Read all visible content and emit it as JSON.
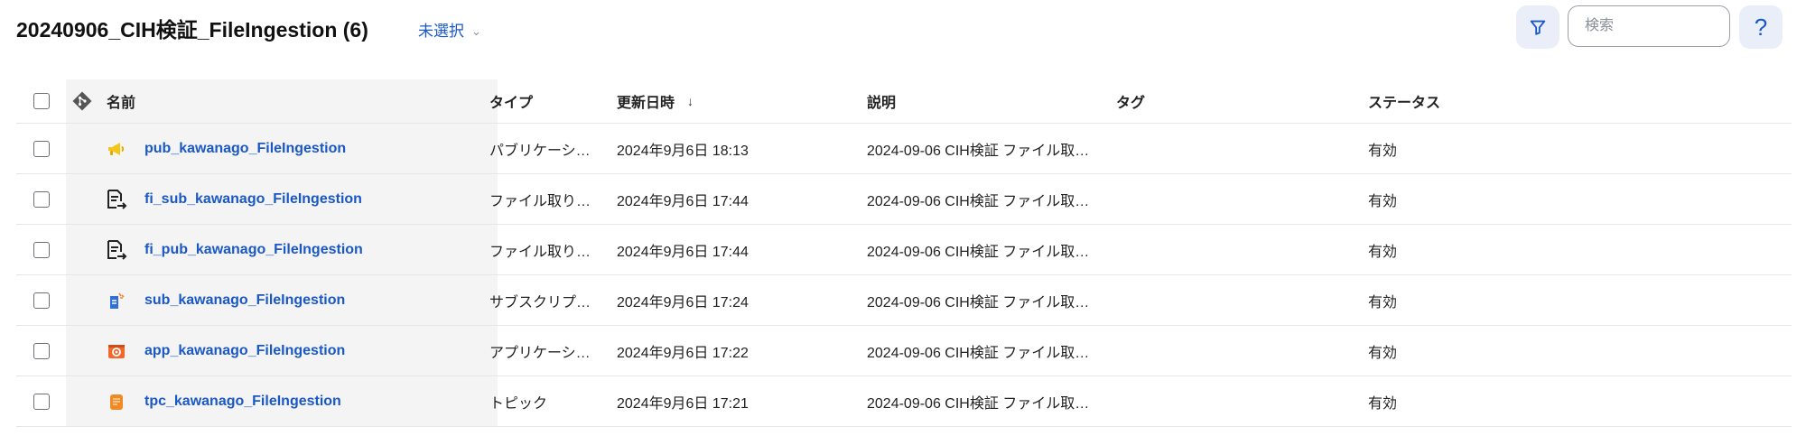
{
  "header": {
    "title": "20240906_CIH検証_FileIngestion (6)",
    "selector_label": "未選択",
    "search_placeholder": "検索",
    "help_label": "?"
  },
  "table": {
    "columns": {
      "name": "名前",
      "type": "タイプ",
      "date": "更新日時",
      "date_sort": "↓",
      "desc": "説明",
      "tag": "タグ",
      "status": "ステータス"
    },
    "rows": [
      {
        "icon": "megaphone-icon",
        "name": "pub_kawanago_FileIngestion",
        "type": "パブリケーシ…",
        "date": "2024年9月6日 18:13",
        "desc": "2024-09-06 CIH検証 ファイル取…",
        "tag": "",
        "status": "有効"
      },
      {
        "icon": "file-ingestion-icon",
        "name": "fi_sub_kawanago_FileIngestion",
        "type": "ファイル取り…",
        "date": "2024年9月6日 17:44",
        "desc": "2024-09-06 CIH検証 ファイル取…",
        "tag": "",
        "status": "有効"
      },
      {
        "icon": "file-ingestion-icon",
        "name": "fi_pub_kawanago_FileIngestion",
        "type": "ファイル取り…",
        "date": "2024年9月6日 17:44",
        "desc": "2024-09-06 CIH検証 ファイル取…",
        "tag": "",
        "status": "有効"
      },
      {
        "icon": "subscription-icon",
        "name": "sub_kawanago_FileIngestion",
        "type": "サブスクリプ…",
        "date": "2024年9月6日 17:24",
        "desc": "2024-09-06 CIH検証 ファイル取…",
        "tag": "",
        "status": "有効"
      },
      {
        "icon": "application-icon",
        "name": "app_kawanago_FileIngestion",
        "type": "アプリケーシ…",
        "date": "2024年9月6日 17:22",
        "desc": "2024-09-06 CIH検証 ファイル取…",
        "tag": "",
        "status": "有効"
      },
      {
        "icon": "topic-icon",
        "name": "tpc_kawanago_FileIngestion",
        "type": "トピック",
        "date": "2024年9月6日 17:21",
        "desc": "2024-09-06 CIH検証 ファイル取…",
        "tag": "",
        "status": "有効"
      }
    ]
  },
  "colors": {
    "link": "#1a58c7",
    "icon_button_bg": "#e9eef8",
    "name_column_bg": "#f4f4f4",
    "megaphone": "#f5c518",
    "subscription": "#2f6fd6",
    "application": "#ef6a2b",
    "topic": "#f08a24"
  }
}
